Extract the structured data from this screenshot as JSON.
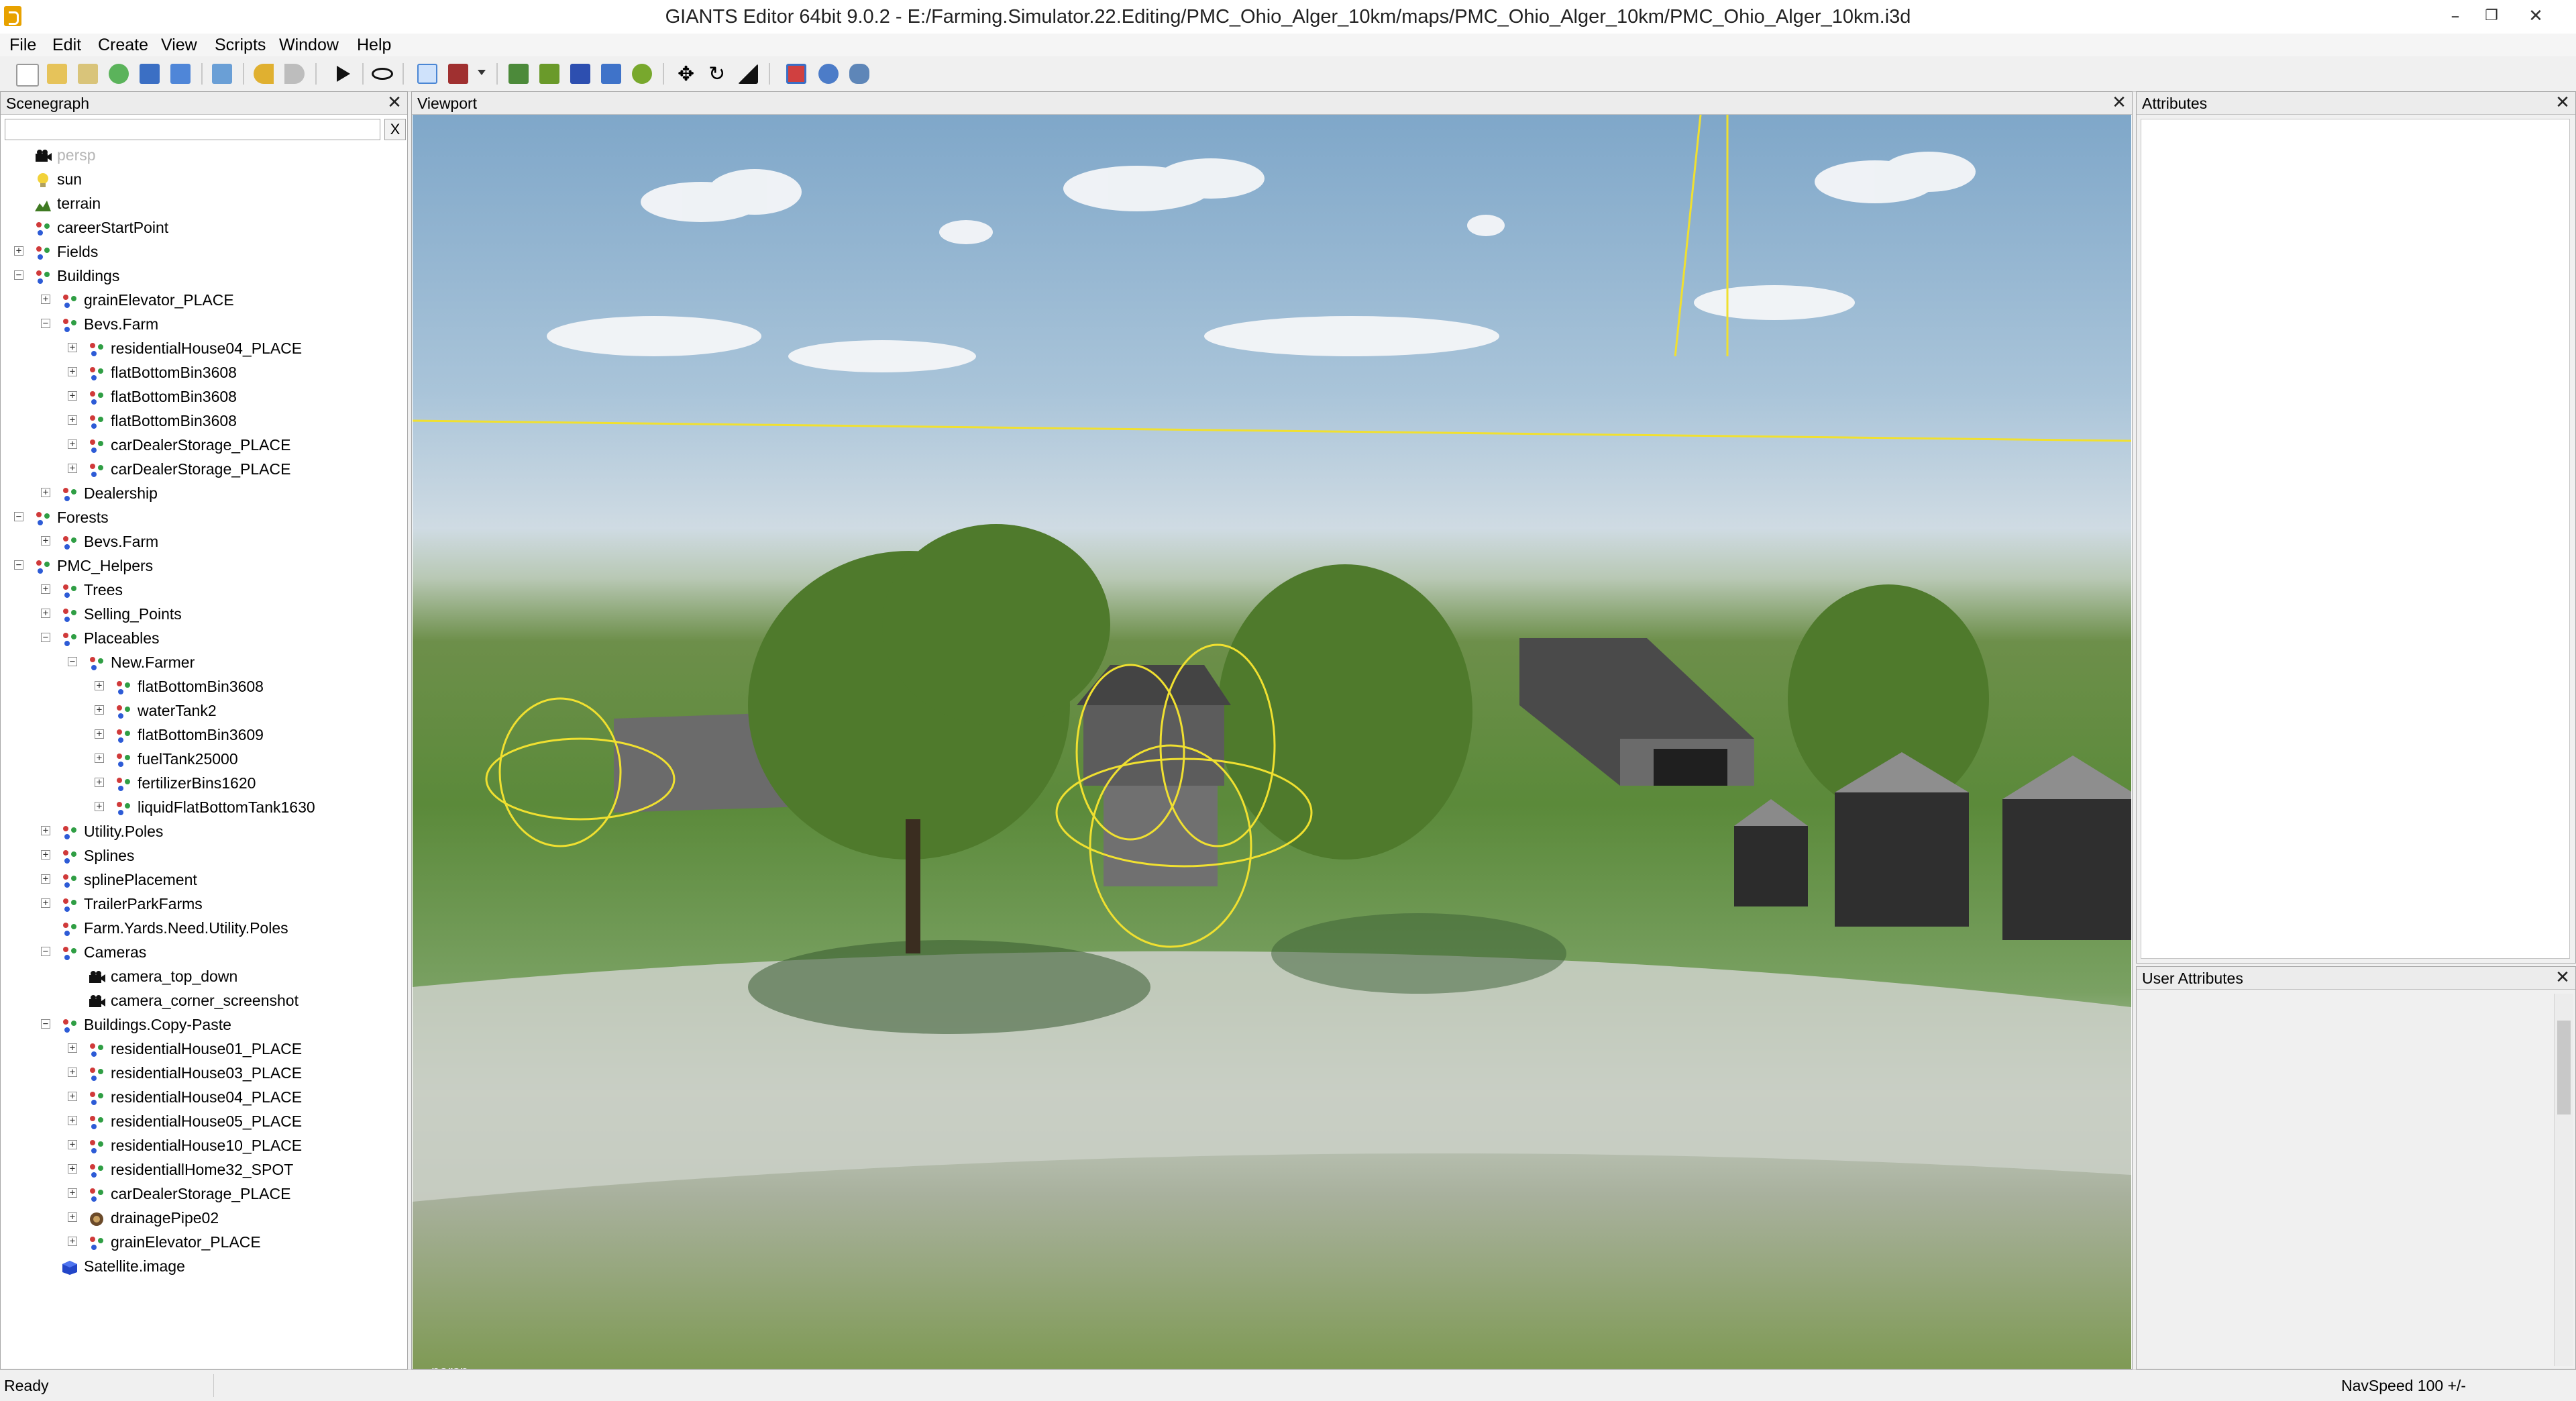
{
  "window": {
    "title": "GIANTS Editor 64bit 9.0.2 - E:/Farming.Simulator.22.Editing/PMC_Ohio_Alger_10km/maps/PMC_Ohio_Alger_10km/PMC_Ohio_Alger_10km.i3d",
    "minimize": "–",
    "restore": "❐",
    "close": "✕"
  },
  "menu": [
    "File",
    "Edit",
    "Create",
    "View",
    "Scripts",
    "Window",
    "Help"
  ],
  "toolbar": {
    "icons": [
      "new-file-icon",
      "open-file-icon",
      "edit-file-icon",
      "reload-icon",
      "save-icon",
      "save-as-icon",
      "import-icon",
      "undo-icon",
      "redo-icon",
      "play-icon",
      "eye-icon",
      "select-icon",
      "paint-icon",
      "terrain-sculpt-icon",
      "terrain-paint-icon",
      "foliage-paint-icon",
      "placeable-icon",
      "tree-paint-icon",
      "move-icon",
      "rotate-icon",
      "scale-icon",
      "shader-icon",
      "material-icon",
      "settings-icon"
    ]
  },
  "scenegraph": {
    "title": "Scenegraph",
    "close": "✕",
    "search_placeholder": "",
    "clear_label": "X",
    "items": [
      {
        "label": "persp",
        "depth": 0,
        "icon": "camera-icon",
        "expander": "none",
        "dim": true
      },
      {
        "label": "sun",
        "depth": 0,
        "icon": "light-bulb-icon",
        "expander": "none"
      },
      {
        "label": "terrain",
        "depth": 0,
        "icon": "terrain-icon",
        "expander": "none"
      },
      {
        "label": "careerStartPoint",
        "depth": 0,
        "icon": "transform-group-icon",
        "expander": "none"
      },
      {
        "label": "Fields",
        "depth": 0,
        "icon": "transform-group-icon",
        "expander": "+"
      },
      {
        "label": "Buildings",
        "depth": 0,
        "icon": "transform-group-icon",
        "expander": "−"
      },
      {
        "label": "grainElevator_PLACE",
        "depth": 1,
        "icon": "transform-group-icon",
        "expander": "+"
      },
      {
        "label": "Bevs.Farm",
        "depth": 1,
        "icon": "transform-group-icon",
        "expander": "−"
      },
      {
        "label": "residentialHouse04_PLACE",
        "depth": 2,
        "icon": "transform-group-icon",
        "expander": "+"
      },
      {
        "label": "flatBottomBin3608",
        "depth": 2,
        "icon": "transform-group-icon",
        "expander": "+"
      },
      {
        "label": "flatBottomBin3608",
        "depth": 2,
        "icon": "transform-group-icon",
        "expander": "+"
      },
      {
        "label": "flatBottomBin3608",
        "depth": 2,
        "icon": "transform-group-icon",
        "expander": "+"
      },
      {
        "label": "carDealerStorage_PLACE",
        "depth": 2,
        "icon": "transform-group-icon",
        "expander": "+"
      },
      {
        "label": "carDealerStorage_PLACE",
        "depth": 2,
        "icon": "transform-group-icon",
        "expander": "+"
      },
      {
        "label": "Dealership",
        "depth": 1,
        "icon": "transform-group-icon",
        "expander": "+"
      },
      {
        "label": "Forests",
        "depth": 0,
        "icon": "transform-group-icon",
        "expander": "−"
      },
      {
        "label": "Bevs.Farm",
        "depth": 1,
        "icon": "transform-group-icon",
        "expander": "+"
      },
      {
        "label": "PMC_Helpers",
        "depth": 0,
        "icon": "transform-group-icon",
        "expander": "−"
      },
      {
        "label": "Trees",
        "depth": 1,
        "icon": "transform-group-icon",
        "expander": "+"
      },
      {
        "label": "Selling_Points",
        "depth": 1,
        "icon": "transform-group-icon",
        "expander": "+"
      },
      {
        "label": "Placeables",
        "depth": 1,
        "icon": "transform-group-icon",
        "expander": "−"
      },
      {
        "label": "New.Farmer",
        "depth": 2,
        "icon": "transform-group-icon",
        "expander": "−"
      },
      {
        "label": "flatBottomBin3608",
        "depth": 3,
        "icon": "transform-group-icon",
        "expander": "+"
      },
      {
        "label": "waterTank2",
        "depth": 3,
        "icon": "transform-group-icon",
        "expander": "+"
      },
      {
        "label": "flatBottomBin3609",
        "depth": 3,
        "icon": "transform-group-icon",
        "expander": "+"
      },
      {
        "label": "fuelTank25000",
        "depth": 3,
        "icon": "transform-group-icon",
        "expander": "+"
      },
      {
        "label": "fertilizerBins1620",
        "depth": 3,
        "icon": "transform-group-icon",
        "expander": "+"
      },
      {
        "label": "liquidFlatBottomTank1630",
        "depth": 3,
        "icon": "transform-group-icon",
        "expander": "+"
      },
      {
        "label": "Utility.Poles",
        "depth": 1,
        "icon": "transform-group-icon",
        "expander": "+"
      },
      {
        "label": "Splines",
        "depth": 1,
        "icon": "transform-group-icon",
        "expander": "+"
      },
      {
        "label": "splinePlacement",
        "depth": 1,
        "icon": "transform-group-icon",
        "expander": "+"
      },
      {
        "label": "TrailerParkFarms",
        "depth": 1,
        "icon": "transform-group-icon",
        "expander": "+"
      },
      {
        "label": "Farm.Yards.Need.Utility.Poles",
        "depth": 1,
        "icon": "transform-group-icon",
        "expander": "none"
      },
      {
        "label": "Cameras",
        "depth": 1,
        "icon": "transform-group-icon",
        "expander": "−"
      },
      {
        "label": "camera_top_down",
        "depth": 2,
        "icon": "camera-icon",
        "expander": "none"
      },
      {
        "label": "camera_corner_screenshot",
        "depth": 2,
        "icon": "camera-icon",
        "expander": "none"
      },
      {
        "label": "Buildings.Copy-Paste",
        "depth": 1,
        "icon": "transform-group-icon",
        "expander": "−"
      },
      {
        "label": "residentialHouse01_PLACE",
        "depth": 2,
        "icon": "transform-group-icon",
        "expander": "+"
      },
      {
        "label": "residentialHouse03_PLACE",
        "depth": 2,
        "icon": "transform-group-icon",
        "expander": "+"
      },
      {
        "label": "residentialHouse04_PLACE",
        "depth": 2,
        "icon": "transform-group-icon",
        "expander": "+"
      },
      {
        "label": "residentialHouse05_PLACE",
        "depth": 2,
        "icon": "transform-group-icon",
        "expander": "+"
      },
      {
        "label": "residentialHouse10_PLACE",
        "depth": 2,
        "icon": "transform-group-icon",
        "expander": "+"
      },
      {
        "label": "residentiallHome32_SPOT",
        "depth": 2,
        "icon": "transform-group-icon",
        "expander": "+"
      },
      {
        "label": "carDealerStorage_PLACE",
        "depth": 2,
        "icon": "transform-group-icon",
        "expander": "+"
      },
      {
        "label": "drainagePipe02",
        "depth": 2,
        "icon": "shape-icon",
        "expander": "+"
      },
      {
        "label": "grainElevator_PLACE",
        "depth": 2,
        "icon": "transform-group-icon",
        "expander": "+"
      },
      {
        "label": "Satellite.image",
        "depth": 1,
        "icon": "cube-icon",
        "expander": "none"
      }
    ]
  },
  "viewport": {
    "title": "Viewport",
    "close": "✕",
    "camera_label": "persp"
  },
  "attributes": {
    "title": "Attributes",
    "close": "✕"
  },
  "user_attributes": {
    "title": "User Attributes",
    "close": "✕"
  },
  "status": {
    "text": "Ready",
    "navspeed": "NavSpeed 100 +/-"
  },
  "colors": {
    "accent": "#3a76d0",
    "gizmo": "#f0e030",
    "tree_red": "#d03a3a",
    "tree_green": "#2f9e44",
    "tree_blue": "#2d5bd6"
  }
}
